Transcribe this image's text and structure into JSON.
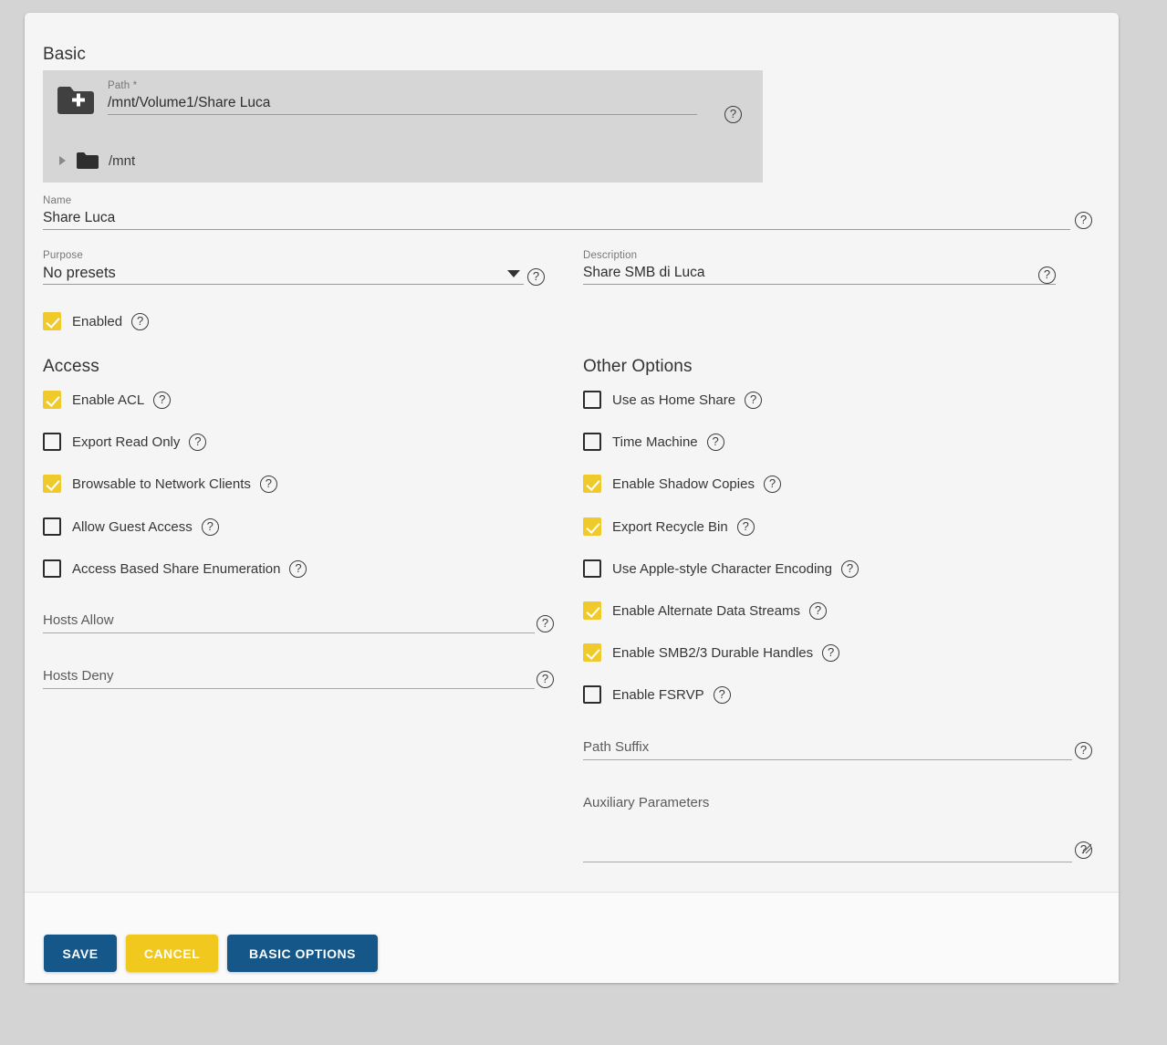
{
  "theme": {
    "accent_blue": "#16578a",
    "accent_yellow": "#f0c81e",
    "checkbox_checked": "#f0c92a",
    "page_background": "#d4d4d4",
    "card_background": "#f5f5f5",
    "path_panel_background": "#d6d6d6"
  },
  "basic": {
    "heading": "Basic",
    "path": {
      "label": "Path *",
      "value": "/mnt/Volume1/Share Luca",
      "help": "?",
      "add_folder_icon": "folder-add-icon",
      "tree": [
        {
          "caret": "caret-right-icon",
          "icon": "folder-icon",
          "label": "/mnt"
        }
      ]
    },
    "name": {
      "label": "Name",
      "value": "Share Luca",
      "help": "?"
    },
    "purpose": {
      "label": "Purpose",
      "value": "No presets",
      "caret": "chevron-down-icon",
      "help": "?"
    },
    "description": {
      "label": "Description",
      "value": "Share SMB di Luca",
      "help": "?"
    },
    "enabled": {
      "label": "Enabled",
      "checked": true,
      "help": "?"
    }
  },
  "access": {
    "heading": "Access",
    "checkboxes": [
      {
        "label": "Enable ACL",
        "checked": true,
        "help": "?"
      },
      {
        "label": "Export Read Only",
        "checked": false,
        "help": "?"
      },
      {
        "label": "Browsable to Network Clients",
        "checked": true,
        "help": "?"
      },
      {
        "label": "Allow Guest Access",
        "checked": false,
        "help": "?"
      },
      {
        "label": "Access Based Share Enumeration",
        "checked": false,
        "help": "?"
      }
    ],
    "hosts_allow": {
      "label": "Hosts Allow",
      "value": "",
      "help": "?"
    },
    "hosts_deny": {
      "label": "Hosts Deny",
      "value": "",
      "help": "?"
    }
  },
  "other_options": {
    "heading": "Other Options",
    "checkboxes": [
      {
        "label": "Use as Home Share",
        "checked": false,
        "help": "?"
      },
      {
        "label": "Time Machine",
        "checked": false,
        "help": "?"
      },
      {
        "label": "Enable Shadow Copies",
        "checked": true,
        "help": "?"
      },
      {
        "label": "Export Recycle Bin",
        "checked": true,
        "help": "?"
      },
      {
        "label": "Use Apple-style Character Encoding",
        "checked": false,
        "help": "?"
      },
      {
        "label": "Enable Alternate Data Streams",
        "checked": true,
        "help": "?"
      },
      {
        "label": "Enable SMB2/3 Durable Handles",
        "checked": true,
        "help": "?"
      },
      {
        "label": "Enable FSRVP",
        "checked": false,
        "help": "?"
      }
    ],
    "path_suffix": {
      "label": "Path Suffix",
      "value": "",
      "help": "?"
    },
    "auxiliary_parameters": {
      "label": "Auxiliary Parameters",
      "value": "",
      "help": "?"
    }
  },
  "footer": {
    "save_label": "SAVE",
    "cancel_label": "CANCEL",
    "basic_options_label": "BASIC OPTIONS"
  }
}
